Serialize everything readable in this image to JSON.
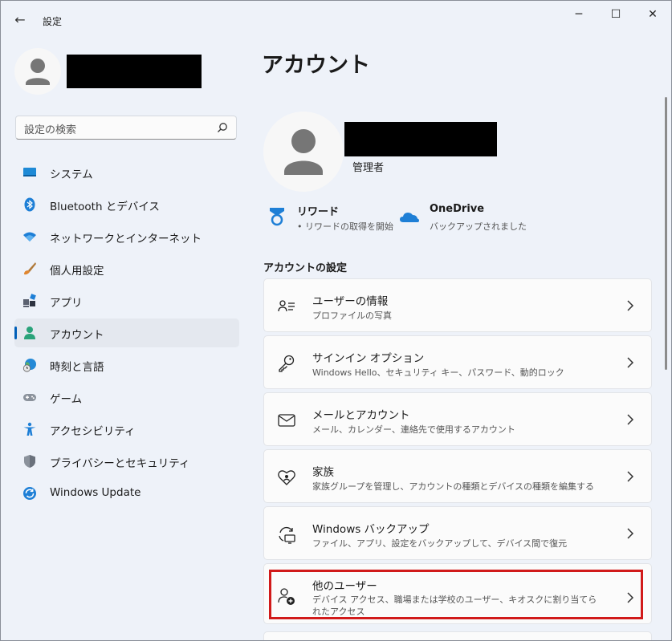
{
  "window": {
    "title": "設定",
    "back_icon": "arrow-left-icon",
    "controls": {
      "minimize": "─",
      "maximize": "☐",
      "close": "✕"
    }
  },
  "sidebar": {
    "search": {
      "placeholder": "設定の検索",
      "icon": "search-icon"
    },
    "items": [
      {
        "label": "システム",
        "icon": "system-monitor-icon",
        "active": false
      },
      {
        "label": "Bluetooth とデバイス",
        "icon": "bluetooth-icon",
        "active": false
      },
      {
        "label": "ネットワークとインターネット",
        "icon": "wifi-icon",
        "active": false
      },
      {
        "label": "個人用設定",
        "icon": "paintbrush-icon",
        "active": false
      },
      {
        "label": "アプリ",
        "icon": "apps-icon",
        "active": false
      },
      {
        "label": "アカウント",
        "icon": "account-icon",
        "active": true
      },
      {
        "label": "時刻と言語",
        "icon": "globe-clock-icon",
        "active": false
      },
      {
        "label": "ゲーム",
        "icon": "gamepad-icon",
        "active": false
      },
      {
        "label": "アクセシビリティ",
        "icon": "accessibility-icon",
        "active": false
      },
      {
        "label": "プライバシーとセキュリティ",
        "icon": "shield-icon",
        "active": false
      },
      {
        "label": "Windows Update",
        "icon": "update-icon",
        "active": false
      }
    ]
  },
  "main": {
    "title": "アカウント",
    "profile": {
      "role": "管理者"
    },
    "services": [
      {
        "title": "リワード",
        "subtitle": "• リワードの取得を開始",
        "icon": "rewards-medal-icon"
      },
      {
        "title": "OneDrive",
        "subtitle": "バックアップされました",
        "icon": "onedrive-cloud-icon"
      }
    ],
    "section_title": "アカウントの設定",
    "settings": [
      {
        "title": "ユーザーの情報",
        "subtitle": "プロファイルの写真",
        "icon": "user-info-icon"
      },
      {
        "title": "サインイン オプション",
        "subtitle": "Windows Hello、セキュリティ キー、パスワード、動的ロック",
        "icon": "key-icon"
      },
      {
        "title": "メールとアカウント",
        "subtitle": "メール、カレンダー、連絡先で使用するアカウント",
        "icon": "mail-icon"
      },
      {
        "title": "家族",
        "subtitle": "家族グループを管理し、アカウントの種類とデバイスの種類を編集する",
        "icon": "family-heart-icon"
      },
      {
        "title": "Windows バックアップ",
        "subtitle": "ファイル、アプリ、設定をバックアップして、デバイス間で復元",
        "icon": "backup-icon"
      },
      {
        "title": "他のユーザー",
        "subtitle": "デバイス アクセス、職場または学校のユーザー、キオスクに割り当てられたアクセス",
        "icon": "add-user-icon"
      }
    ]
  },
  "colors": {
    "accent": "#005fb8",
    "highlight_border": "#d11a1a",
    "background": "#eef2f9"
  }
}
